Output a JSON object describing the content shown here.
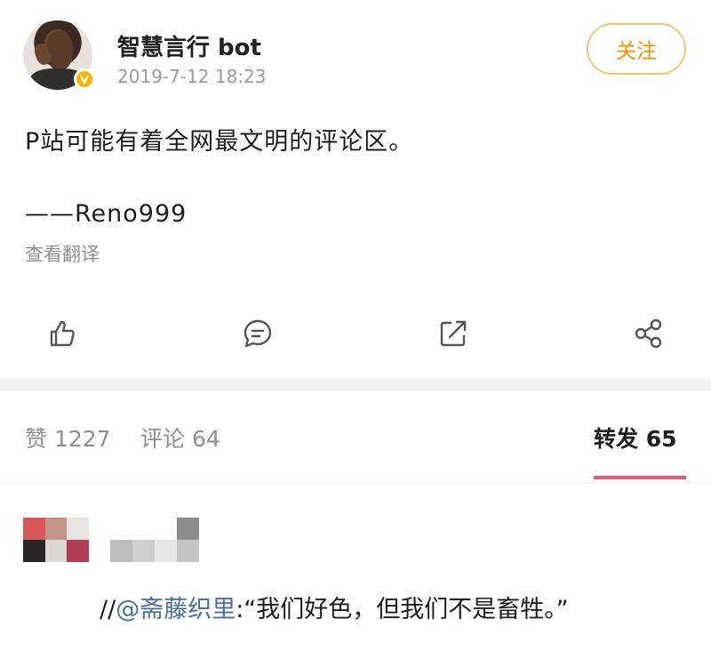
{
  "post": {
    "username": "智慧言行 bot",
    "timestamp": "2019-7-12 18:23",
    "follow_label": "关注",
    "text_line1": "P站可能有着全网最文明的评论区。",
    "text_line2": "——Reno999",
    "translate_label": "查看翻译"
  },
  "actions": [
    {
      "icon": "like-icon"
    },
    {
      "icon": "comment-icon"
    },
    {
      "icon": "repost-icon"
    },
    {
      "icon": "share-icon"
    }
  ],
  "stats": {
    "likes": "赞 1227",
    "comments": "评论 64",
    "reposts": "转发 65"
  },
  "repost_item": {
    "prefix": "//",
    "mention": "@斋藤织里",
    "quote": ":“我们好色，但我们不是畜牲。”"
  },
  "colors": {
    "accent_follow": "#f09000",
    "active_tab_underline": "#e8576a",
    "mention": "#4a6f9c",
    "verified_badge": "#f5b400"
  }
}
